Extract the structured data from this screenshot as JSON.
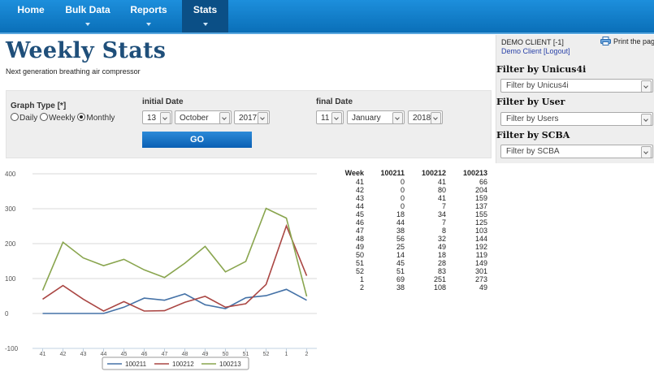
{
  "nav": {
    "items": [
      {
        "label": "Home",
        "dropdown": false,
        "active": false
      },
      {
        "label": "Bulk Data",
        "dropdown": true,
        "active": false
      },
      {
        "label": "Reports",
        "dropdown": true,
        "active": false
      },
      {
        "label": "Stats",
        "dropdown": true,
        "active": true
      }
    ]
  },
  "page": {
    "title": "Weekly Stats",
    "subtitle": "Next generation breathing air compressor"
  },
  "filters": {
    "graph_type_label": "Graph Type [*]",
    "radio_options": [
      {
        "label": "Daily",
        "selected": false
      },
      {
        "label": "Weekly",
        "selected": false
      },
      {
        "label": "Monthly",
        "selected": true
      }
    ],
    "initial_date_label": "initial Date",
    "initial_day": "13",
    "initial_month": "October",
    "initial_year": "2017",
    "final_date_label": "final Date",
    "final_day": "11",
    "final_month": "January",
    "final_year": "2018",
    "go_label": "GO"
  },
  "sidebar": {
    "client_name": "DEMO CLIENT [-1]",
    "client_link": "Demo Client",
    "logout": "[Logout]",
    "print_label": "Print the page",
    "unicus_heading": "Filter by Unicus4i",
    "unicus_placeholder": "Filter by Unicus4i",
    "user_heading": "Filter by User",
    "user_placeholder": "Filter by Users",
    "scba_heading": "Filter by SCBA",
    "scba_placeholder": "Filter by SCBA"
  },
  "chart_data": {
    "type": "line",
    "categories": [
      "41",
      "42",
      "43",
      "44",
      "45",
      "46",
      "47",
      "48",
      "49",
      "50",
      "51",
      "52",
      "1",
      "2"
    ],
    "series": [
      {
        "name": "100211",
        "color": "#4572a7",
        "values": [
          0,
          0,
          0,
          0,
          18,
          44,
          38,
          56,
          25,
          14,
          45,
          51,
          69,
          38
        ]
      },
      {
        "name": "100212",
        "color": "#aa4643",
        "values": [
          41,
          80,
          41,
          7,
          34,
          7,
          8,
          32,
          49,
          18,
          28,
          83,
          251,
          108
        ]
      },
      {
        "name": "100213",
        "color": "#89a54e",
        "values": [
          66,
          204,
          159,
          137,
          155,
          125,
          103,
          144,
          192,
          119,
          149,
          301,
          273,
          49
        ]
      }
    ],
    "yticks": [
      400,
      300,
      200,
      100,
      0,
      -100
    ],
    "ylim": [
      -100,
      400
    ],
    "grid": true,
    "legend_position": "bottom-center"
  },
  "table": {
    "headers": [
      "Week",
      "100211",
      "100212",
      "100213"
    ],
    "rows": [
      [
        "41",
        "0",
        "41",
        "66"
      ],
      [
        "42",
        "0",
        "80",
        "204"
      ],
      [
        "43",
        "0",
        "41",
        "159"
      ],
      [
        "44",
        "0",
        "7",
        "137"
      ],
      [
        "45",
        "18",
        "34",
        "155"
      ],
      [
        "46",
        "44",
        "7",
        "125"
      ],
      [
        "47",
        "38",
        "8",
        "103"
      ],
      [
        "48",
        "56",
        "32",
        "144"
      ],
      [
        "49",
        "25",
        "49",
        "192"
      ],
      [
        "50",
        "14",
        "18",
        "119"
      ],
      [
        "51",
        "45",
        "28",
        "149"
      ],
      [
        "52",
        "51",
        "83",
        "301"
      ],
      [
        "1",
        "69",
        "251",
        "273"
      ],
      [
        "2",
        "38",
        "108",
        "49"
      ]
    ]
  }
}
